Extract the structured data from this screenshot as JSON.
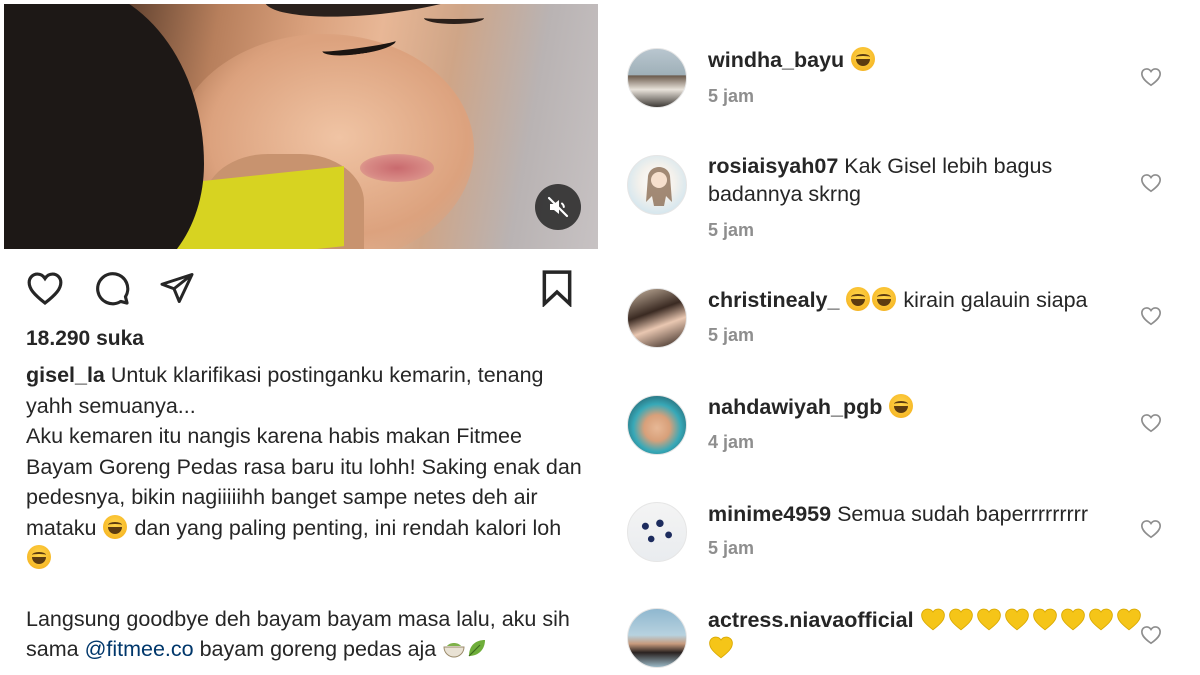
{
  "post": {
    "likes": "18.290 suka",
    "caption": {
      "username": "gisel_la",
      "line1": " Untuk klarifikasi postinganku kemarin, tenang yahh semuanya...",
      "line2a": "Aku kemaren itu nangis karena habis makan Fitmee Bayam Goreng Pedas rasa baru itu lohh! Saking enak dan pedesnya, bikin nagiiiiihh banget sampe netes deh air mataku ",
      "line2b": " dan yang paling penting, ini rendah kalori loh ",
      "line3a": "Langsung goodbye deh bayam bayam masa lalu, aku sih sama ",
      "mention": "@fitmee.co",
      "line3b": " bayam goreng pedas aja "
    }
  },
  "comments": [
    {
      "user": "windha_bayu",
      "text": " ",
      "time": "5 jam",
      "emojis": 1
    },
    {
      "user": "rosiaisyah07",
      "text": " Kak Gisel lebih bagus badannya skrng",
      "time": "5 jam",
      "emojis": 0
    },
    {
      "user": "christinealy_",
      "text": " kirain galauin siapa",
      "time": "5 jam",
      "emojis": 2
    },
    {
      "user": "nahdawiyah_pgb",
      "text": " ",
      "time": "4 jam",
      "emojis": 1
    },
    {
      "user": "minime4959",
      "text": " Semua sudah baperrrrrrrrr",
      "time": "5 jam",
      "emojis": 0
    },
    {
      "user": "actress.niavaofficial",
      "text": " ",
      "time": "",
      "emojis": 0
    }
  ],
  "colors": {
    "text": "#262626",
    "muted": "#8e8e8e",
    "mention": "#00376b",
    "yellow_heart": "#f5c518"
  }
}
